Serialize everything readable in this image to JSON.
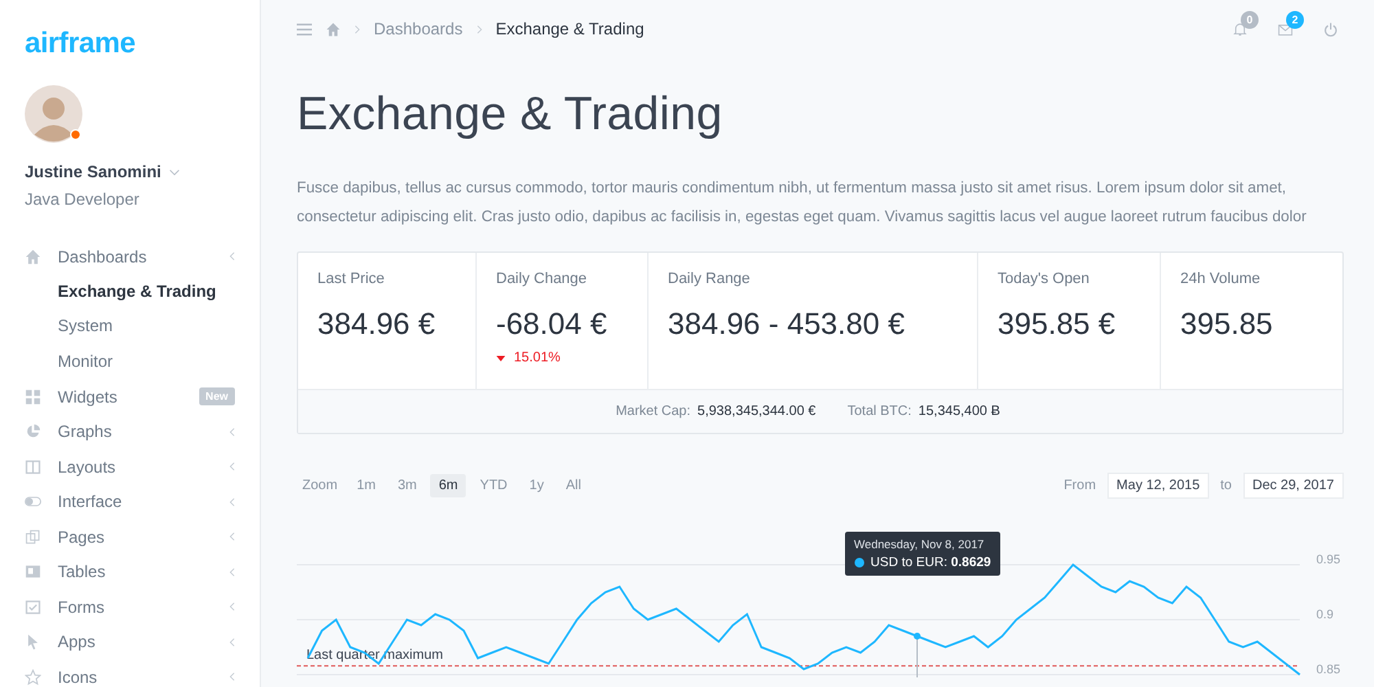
{
  "brand": "airframe",
  "user": {
    "name": "Justine Sanomini",
    "role": "Java Developer",
    "online": true
  },
  "sidebar": {
    "items": [
      {
        "label": "Dashboards",
        "expanded": true,
        "children": [
          {
            "label": "Exchange & Trading",
            "selected": true
          },
          {
            "label": "System",
            "selected": false
          },
          {
            "label": "Monitor",
            "selected": false
          }
        ]
      },
      {
        "label": "Widgets",
        "badge": "New"
      },
      {
        "label": "Graphs"
      },
      {
        "label": "Layouts"
      },
      {
        "label": "Interface"
      },
      {
        "label": "Pages"
      },
      {
        "label": "Tables"
      },
      {
        "label": "Forms"
      },
      {
        "label": "Apps"
      },
      {
        "label": "Icons"
      }
    ]
  },
  "breadcrumb": [
    "Dashboards",
    "Exchange & Trading"
  ],
  "notifications": [
    {
      "count": "0",
      "color": "#b4bcc6"
    },
    {
      "count": "2",
      "color": "#1eb7ff"
    }
  ],
  "title": "Exchange & Trading",
  "intro": "Fusce dapibus, tellus ac cursus commodo, tortor mauris condimentum nibh, ut fermentum massa justo sit amet risus. Lorem ipsum dolor sit amet, consectetur adipiscing elit. Cras justo odio, dapibus ac facilisis in, egestas eget quam. Vivamus sagittis lacus vel augue laoreet rutrum faucibus dolor",
  "stats": [
    {
      "label": "Last Price",
      "value": "384.96 €"
    },
    {
      "label": "Daily Change",
      "value": "-68.04 €",
      "change": "15.01%",
      "down": true
    },
    {
      "label": "Daily Range",
      "value": "384.96 - 453.80 €"
    },
    {
      "label": "Today's Open",
      "value": "395.85 €"
    },
    {
      "label": "24h Volume",
      "value": "395.85"
    }
  ],
  "summary": [
    {
      "label": "Market Cap:",
      "value": "5,938,345,344.00 €"
    },
    {
      "label": "Total BTC:",
      "value": "15,345,400 Ƀ"
    }
  ],
  "zoom": {
    "label": "Zoom",
    "options": [
      {
        "label": "1m",
        "selected": false
      },
      {
        "label": "3m",
        "selected": false
      },
      {
        "label": "6m",
        "selected": true
      },
      {
        "label": "YTD",
        "selected": false
      },
      {
        "label": "1y",
        "selected": false
      },
      {
        "label": "All",
        "selected": false
      }
    ]
  },
  "range": {
    "from_label": "From",
    "from": "May 12, 2015",
    "to_label": "to",
    "to": "Dec 29, 2017"
  },
  "tooltip": {
    "date": "Wednesday, Nov 8, 2017",
    "series": "USD to EUR:",
    "value": "0.8629"
  },
  "chart_data": {
    "type": "line",
    "ylim": [
      0.85,
      0.95
    ],
    "yticks": [
      0.85,
      0.9,
      0.95
    ],
    "ref_lines": [
      {
        "axis": "y",
        "value": 0.858,
        "label": "Last quarter maximum"
      }
    ],
    "series": [
      {
        "color": "#1eb7ff",
        "values": [
          0.865,
          0.89,
          0.9,
          0.875,
          0.87,
          0.86,
          0.88,
          0.9,
          0.895,
          0.905,
          0.9,
          0.89,
          0.865,
          0.87,
          0.875,
          0.87,
          0.865,
          0.86,
          0.88,
          0.9,
          0.915,
          0.925,
          0.93,
          0.91,
          0.9,
          0.905,
          0.91,
          0.9,
          0.89,
          0.88,
          0.895,
          0.905,
          0.875,
          0.87,
          0.865,
          0.855,
          0.86,
          0.87,
          0.875,
          0.87,
          0.88,
          0.895,
          0.89,
          0.885,
          0.88,
          0.875,
          0.88,
          0.885,
          0.875,
          0.885,
          0.9,
          0.91,
          0.92,
          0.935,
          0.95,
          0.94,
          0.93,
          0.925,
          0.935,
          0.93,
          0.92,
          0.915,
          0.93,
          0.92,
          0.9,
          0.88,
          0.875,
          0.88,
          0.87,
          0.86,
          0.85
        ]
      }
    ]
  }
}
